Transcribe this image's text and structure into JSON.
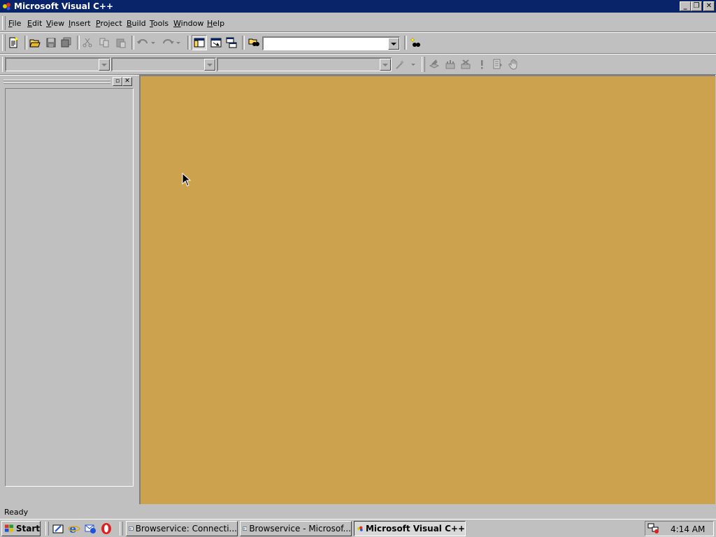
{
  "window": {
    "title": "Microsoft Visual C++"
  },
  "menu": [
    "File",
    "Edit",
    "View",
    "Insert",
    "Project",
    "Build",
    "Tools",
    "Window",
    "Help"
  ],
  "menu_mnemonics": [
    "F",
    "E",
    "V",
    "I",
    "P",
    "B",
    "T",
    "W",
    "H"
  ],
  "toolbar": {
    "standard_icons": [
      "new-text-file-icon",
      "open-icon",
      "save-icon",
      "save-all-icon",
      "cut-icon",
      "copy-icon",
      "paste-icon",
      "undo-icon",
      "redo-icon",
      "workspace-icon",
      "output-icon",
      "window-list-icon",
      "find-in-files-icon",
      "find-icon"
    ],
    "find_combo_value": ""
  },
  "wizardbar": {
    "class_combo_value": "",
    "filter_combo_value": "",
    "members_combo_value": "",
    "build_icons": [
      "compile-icon",
      "build-icon",
      "stop-build-icon",
      "execute-icon",
      "go-icon",
      "breakpoint-icon"
    ]
  },
  "status": {
    "text": "Ready"
  },
  "taskbar": {
    "start_label": "Start",
    "tasks": [
      {
        "label": "Browservice: Connecti...",
        "active": false
      },
      {
        "label": "Browservice - Microsof...",
        "active": false
      },
      {
        "label": "Microsoft Visual C++",
        "active": true
      }
    ],
    "clock": "4:14 AM"
  },
  "colors": {
    "titlebar": "#0a246a",
    "face": "#c0c0c0",
    "mdi_background": "#cca24f"
  }
}
